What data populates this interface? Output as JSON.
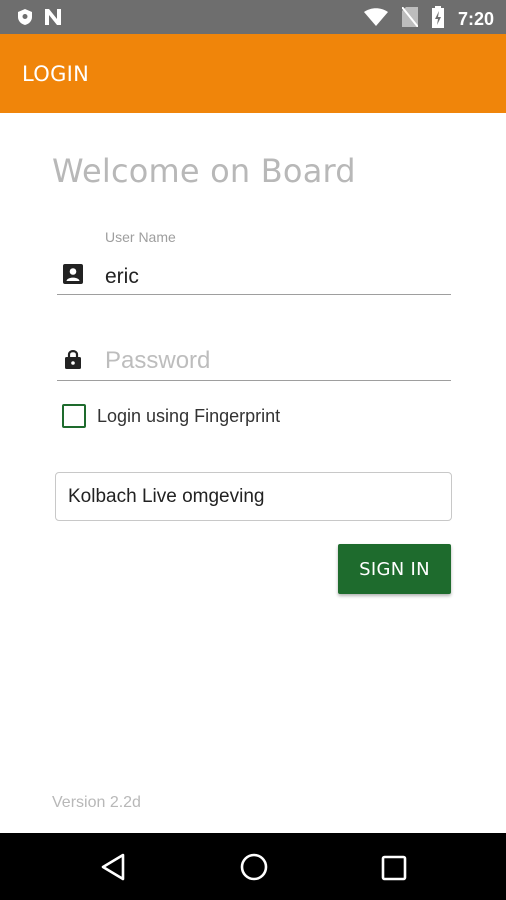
{
  "status_bar": {
    "time": "7:20",
    "icons": [
      "shield-icon",
      "n-notification-icon",
      "wifi-icon",
      "no-sim-icon",
      "battery-charging-icon"
    ]
  },
  "app_bar": {
    "title": "LOGIN"
  },
  "welcome": "Welcome on Board",
  "username": {
    "label": "User Name",
    "value": "eric",
    "icon": "account-box-icon"
  },
  "password": {
    "placeholder": "Password",
    "icon": "lock-icon"
  },
  "fingerprint": {
    "label": "Login using Fingerprint",
    "checked": false
  },
  "environment": {
    "value": "Kolbach Live omgeving"
  },
  "sign_in": {
    "label": "SIGN IN"
  },
  "version": "Version 2.2d",
  "nav_bar": {
    "icons": [
      "back-icon",
      "home-icon",
      "recents-icon"
    ]
  },
  "colors": {
    "accent": "#f0850a",
    "primary_button": "#1e6b2d",
    "status_bar": "#6e6e6e"
  }
}
